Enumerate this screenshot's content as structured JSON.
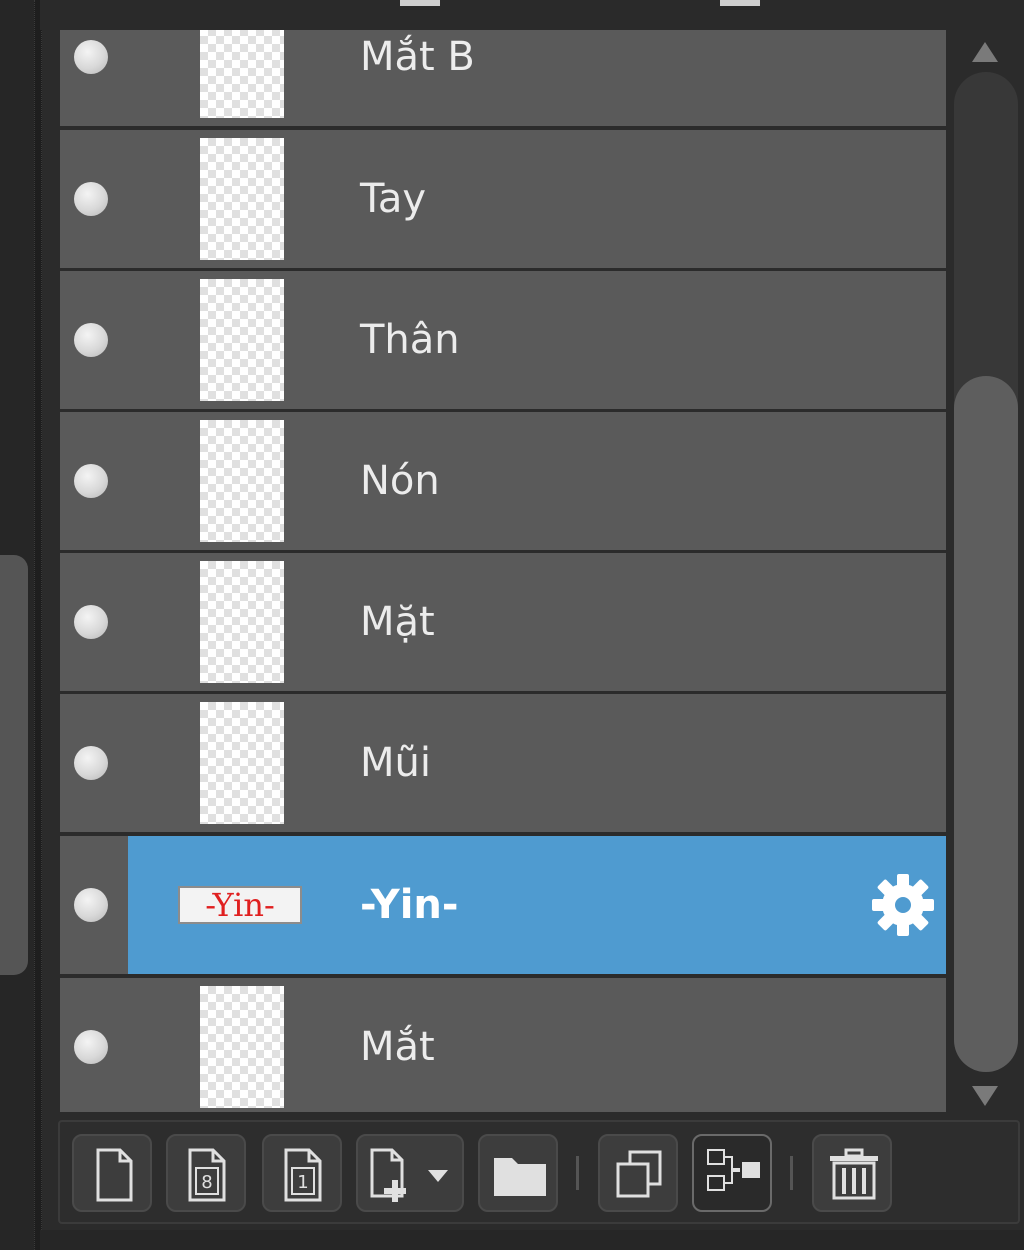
{
  "layers": [
    {
      "name": "Mắt B",
      "type": "raster"
    },
    {
      "name": "Tay",
      "type": "raster"
    },
    {
      "name": "Thân",
      "type": "raster"
    },
    {
      "name": "Nón",
      "type": "raster"
    },
    {
      "name": "Mặt",
      "type": "raster"
    },
    {
      "name": "Mũi",
      "type": "raster"
    },
    {
      "name": "-Yin-",
      "type": "text",
      "selected": true,
      "thumb_text": "-Yin-"
    },
    {
      "name": "Mắt",
      "type": "raster"
    }
  ],
  "toolbar": {
    "buttons": [
      {
        "id": "new-layer",
        "icon": "page-icon"
      },
      {
        "id": "new-layer-8bit",
        "icon": "page-8-icon",
        "label": "8"
      },
      {
        "id": "new-layer-1bit",
        "icon": "page-1-icon",
        "label": "1"
      },
      {
        "id": "add-layer-menu",
        "icon": "page-plus-dropdown-icon"
      },
      {
        "id": "new-folder",
        "icon": "folder-icon"
      },
      {
        "id": "duplicate-layer",
        "icon": "duplicate-icon"
      },
      {
        "id": "merge-layer",
        "icon": "merge-icon"
      },
      {
        "id": "delete-layer",
        "icon": "trash-icon"
      }
    ]
  },
  "colors": {
    "selected_row": "#4f9bd0",
    "row_bg": "#5a5a5a",
    "panel_bg": "#2b2b2b",
    "text_thumb_red": "#e02020"
  }
}
